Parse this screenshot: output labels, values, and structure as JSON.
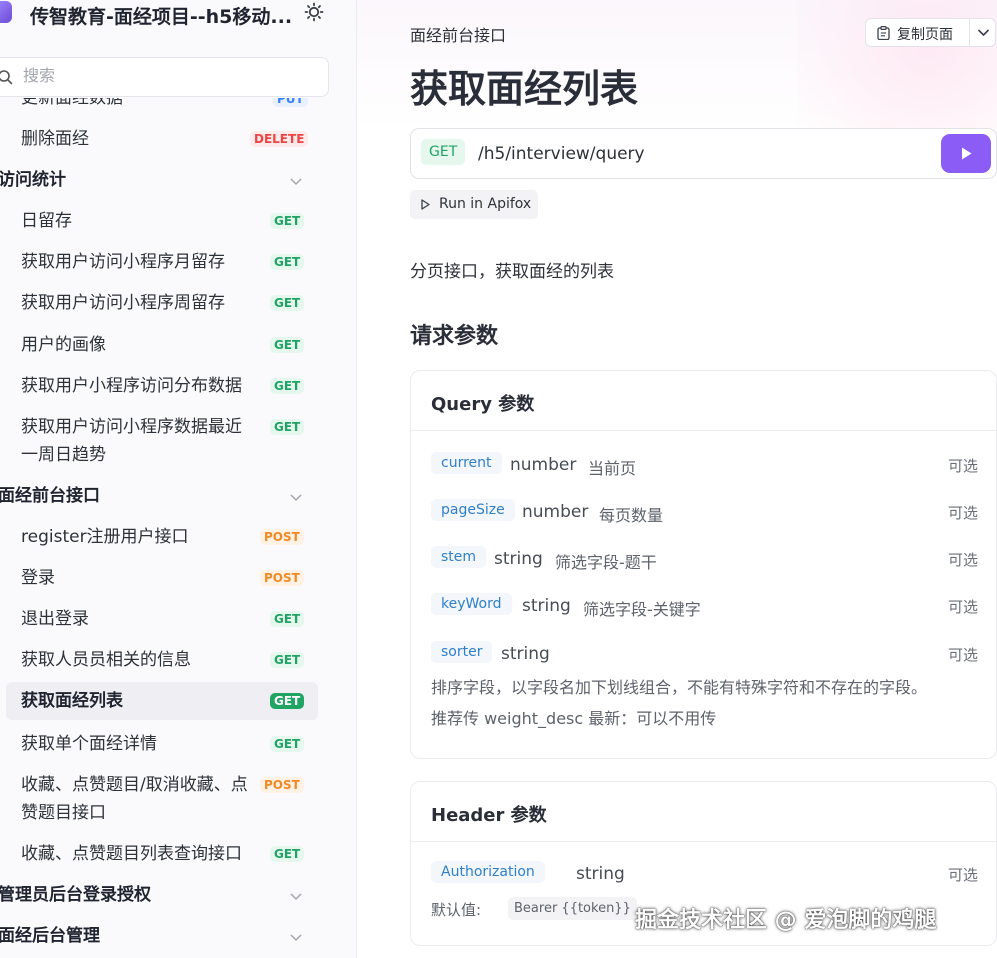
{
  "brand": {
    "title": "传智教育-面经项目--h5移动..."
  },
  "search": {
    "placeholder": "搜索"
  },
  "sidebar": {
    "items": [
      {
        "label": "更新面经数据",
        "method": "PUT"
      },
      {
        "label": "删除面经",
        "method": "DELETE"
      },
      {
        "group": "访问统计"
      },
      {
        "label": "日留存",
        "method": "GET"
      },
      {
        "label": "获取用户访问小程序月留存",
        "method": "GET"
      },
      {
        "label": "获取用户访问小程序周留存",
        "method": "GET"
      },
      {
        "label": "用户的画像",
        "method": "GET"
      },
      {
        "label": "获取用户小程序访问分布数据",
        "method": "GET"
      },
      {
        "label": "获取用户访问小程序数据最近一周日趋势",
        "method": "GET"
      },
      {
        "group": "面经前台接口"
      },
      {
        "label": "register注册用户接口",
        "method": "POST"
      },
      {
        "label": "登录",
        "method": "POST"
      },
      {
        "label": "退出登录",
        "method": "GET"
      },
      {
        "label": "获取人员员相关的信息",
        "method": "GET"
      },
      {
        "label": "获取面经列表",
        "method": "GET",
        "active": true
      },
      {
        "label": "获取单个面经详情",
        "method": "GET"
      },
      {
        "label": "收藏、点赞题目/取消收藏、点赞题目接口",
        "method": "POST"
      },
      {
        "label": "收藏、点赞题目列表查询接口",
        "method": "GET"
      },
      {
        "group": "管理员后台登录授权"
      },
      {
        "group": "面经后台管理"
      }
    ]
  },
  "main": {
    "breadcrumb": "面经前台接口",
    "copy_label": "复制页面",
    "title": "获取面经列表",
    "method": "GET",
    "path": "/h5/interview/query",
    "run_label": "Run in Apifox",
    "description": "分页接口，获取面经的列表",
    "section_title": "请求参数",
    "query": {
      "title": "Query 参数",
      "params": [
        {
          "name": "current",
          "type": "number",
          "desc": "当前页",
          "optional": "可选"
        },
        {
          "name": "pageSize",
          "type": "number",
          "desc": "每页数量",
          "optional": "可选"
        },
        {
          "name": "stem",
          "type": "string",
          "desc": "筛选字段-题干",
          "optional": "可选"
        },
        {
          "name": "keyWord",
          "type": "string",
          "desc": "筛选字段-关键字",
          "optional": "可选"
        },
        {
          "name": "sorter",
          "type": "string",
          "desc": "",
          "optional": "可选"
        }
      ],
      "sorter_note_1": "排序字段，以字段名加下划线组合，不能有特殊字符和不存在的字段。",
      "sorter_note_2": "推荐传 weight_desc 最新：可以不用传"
    },
    "header": {
      "title": "Header 参数",
      "param": {
        "name": "Authorization",
        "type": "string",
        "optional": "可选"
      },
      "default_label": "默认值:",
      "default_value": "Bearer {{token}}"
    }
  },
  "watermark": "掘金技术社区 @ 爱泡脚的鸡腿",
  "colors": {
    "accent": "#8b5cf6",
    "get": "#21a366",
    "post": "#f08a24",
    "delete": "#ef4444",
    "put": "#3b82f6"
  }
}
